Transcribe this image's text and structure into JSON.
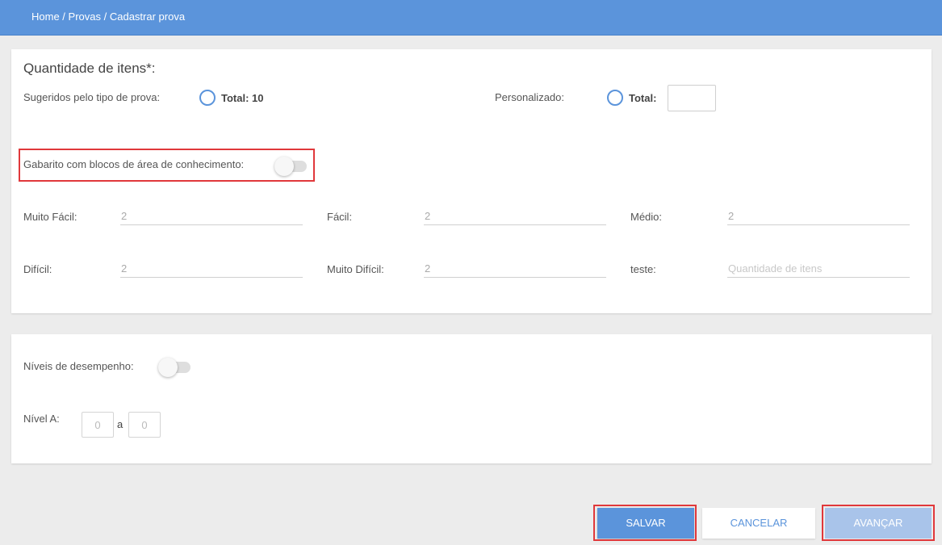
{
  "breadcrumb": {
    "home": "Home",
    "sep1": " / ",
    "provas": "Provas",
    "sep2": " / ",
    "current": "Cadastrar prova"
  },
  "quantity_section": {
    "title": "Quantidade de itens*:",
    "suggested_label": "Sugeridos pelo tipo de prova:",
    "suggested_total": "Total: 10",
    "custom_label": "Personalizado:",
    "custom_total": "Total:",
    "custom_value": ""
  },
  "gabarito": {
    "label": "Gabarito com blocos de área de conhecimento:",
    "enabled": false
  },
  "difficulty": {
    "muito_facil": {
      "label": "Muito Fácil:",
      "value": "2"
    },
    "facil": {
      "label": "Fácil:",
      "value": "2"
    },
    "medio": {
      "label": "Médio:",
      "value": "2"
    },
    "dificil": {
      "label": "Difícil:",
      "value": "2"
    },
    "muito_dificil": {
      "label": "Muito Difícil:",
      "value": "2"
    },
    "teste": {
      "label": "teste:",
      "value": "",
      "placeholder": "Quantidade de itens"
    }
  },
  "performance": {
    "label": "Níveis de desempenho:",
    "enabled": false,
    "level_a_label": "Nível A:",
    "from_value": "0",
    "connector": "a",
    "to_value": "0"
  },
  "actions": {
    "save": "SALVAR",
    "cancel": "CANCELAR",
    "next": "AVANÇAR"
  },
  "colors": {
    "primary": "#5b94db",
    "disabled_primary": "#a9c4ea",
    "highlight": "#e0383b"
  }
}
